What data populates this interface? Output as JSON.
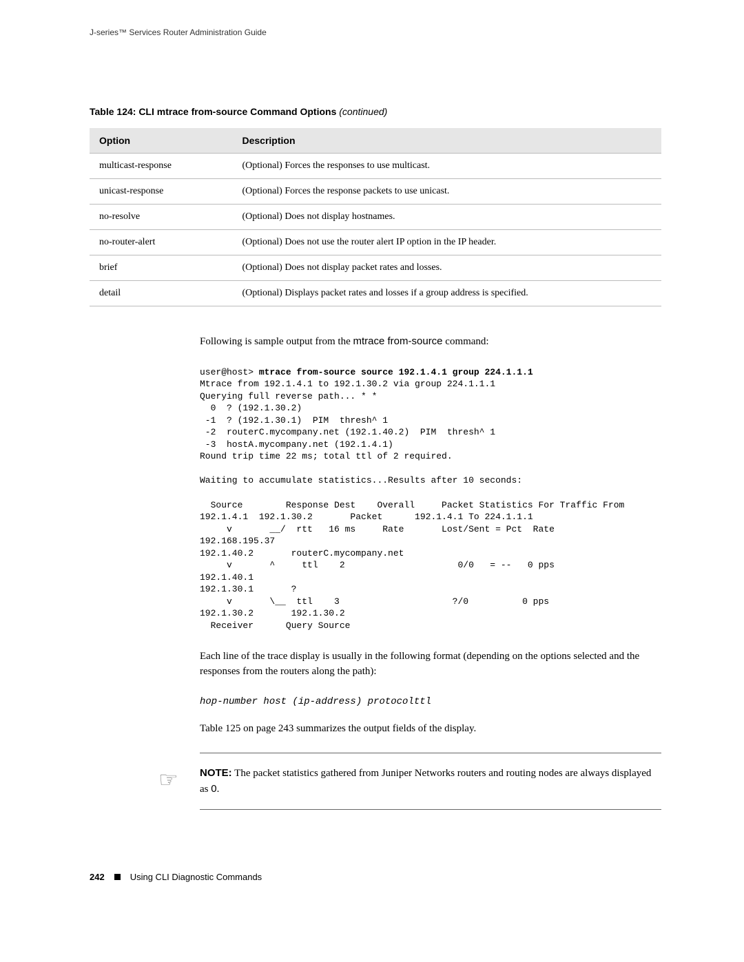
{
  "running_header": "J-series™ Services Router Administration Guide",
  "table_title_bold": "Table 124: CLI mtrace from-source Command Options ",
  "table_title_italic": "(continued)",
  "table": {
    "head_option": "Option",
    "head_description": "Description",
    "rows": [
      {
        "option": "multicast-response",
        "description": "(Optional) Forces the responses to use multicast."
      },
      {
        "option": "unicast-response",
        "description": "(Optional) Forces the response packets to use unicast."
      },
      {
        "option": "no-resolve",
        "description": "(Optional) Does not display hostnames."
      },
      {
        "option": "no-router-alert",
        "description": "(Optional) Does not use the router alert IP option in the IP header."
      },
      {
        "option": "brief",
        "description": "(Optional) Does not display packet rates and losses."
      },
      {
        "option": "detail",
        "description": "(Optional) Displays packet rates and losses if a group address is specified."
      }
    ]
  },
  "intro_line_prefix": "Following is sample output from the ",
  "intro_line_cmd": "mtrace from-source",
  "intro_line_suffix": " command:",
  "cli_prompt": "user@host> ",
  "cli_command": "mtrace from-source source 192.1.4.1 group 224.1.1.1",
  "cli_body": "Mtrace from 192.1.4.1 to 192.1.30.2 via group 224.1.1.1\nQuerying full reverse path... * *\n  0  ? (192.1.30.2)\n -1  ? (192.1.30.1)  PIM  thresh^ 1\n -2  routerC.mycompany.net (192.1.40.2)  PIM  thresh^ 1\n -3  hostA.mycompany.net (192.1.4.1)\nRound trip time 22 ms; total ttl of 2 required.\n\nWaiting to accumulate statistics...Results after 10 seconds:\n\n  Source        Response Dest    Overall     Packet Statistics For Traffic From\n192.1.4.1  192.1.30.2       Packet      192.1.4.1 To 224.1.1.1\n     v       __/  rtt   16 ms     Rate       Lost/Sent = Pct  Rate\n192.168.195.37\n192.1.40.2       routerC.mycompany.net\n     v       ^     ttl    2                     0/0   = --   0 pps\n192.1.40.1\n192.1.30.1       ?\n     v       \\__  ttl    3                     ?/0          0 pps\n192.1.30.2       192.1.30.2\n  Receiver      Query Source",
  "para_format": "Each line of the trace display is usually in the following format (depending on the options selected and the responses from the routers along the path):",
  "syntax_line": "hop-number host (ip-address) protocolttl",
  "summary_line": "Table 125 on page 243 summarizes the output fields of the display.",
  "note_label": "NOTE:",
  "note_text_prefix": " The packet statistics gathered from Juniper Networks routers and routing nodes are always displayed as ",
  "note_code": "0",
  "note_text_suffix": ".",
  "footer_page": "242",
  "footer_section": "Using CLI Diagnostic Commands"
}
